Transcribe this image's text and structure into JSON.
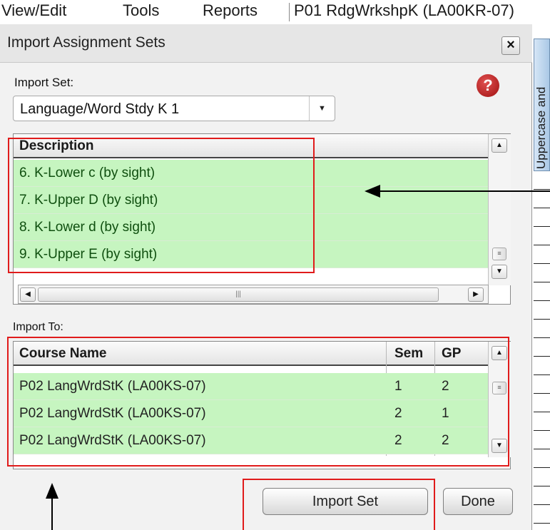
{
  "menubar": {
    "items": [
      "View/Edit",
      "Tools",
      "Reports"
    ],
    "course_context": "P01  RdgWrkshpK (LA00KR-07)"
  },
  "dialog": {
    "title": "Import Assignment Sets",
    "import_set_label": "Import Set:",
    "import_set_value": "Language/Word Stdy K 1",
    "description": {
      "header": "Description",
      "rows": [
        "6. K-Lower c (by sight)",
        "7. K-Upper D (by sight)",
        "8. K-Lower d (by sight)",
        "9. K-Upper E (by sight)"
      ]
    },
    "import_to_label": "Import To:",
    "courses": {
      "headers": {
        "course_name": "Course Name",
        "sem": "Sem",
        "gp": "GP"
      },
      "rows": [
        {
          "course_name": "P02   LangWrdStK (LA00KS-07)",
          "sem": "1",
          "gp": "2"
        },
        {
          "course_name": "P02   LangWrdStK (LA00KS-07)",
          "sem": "2",
          "gp": "1"
        },
        {
          "course_name": "P02   LangWrdStK (LA00KS-07)",
          "sem": "2",
          "gp": "2"
        }
      ]
    },
    "buttons": {
      "import_set": "Import Set",
      "done": "Done",
      "close": "×"
    }
  },
  "right_panel": {
    "tab_label": "Uppercase and"
  },
  "colors": {
    "row_highlight": "#c6f5c0",
    "annotation_red": "#e01b1b",
    "help_icon": "#c0201f"
  },
  "icons": {
    "close": "close-icon",
    "help": "help-icon",
    "dropdown": "chevron-down-icon",
    "scroll_up": "scroll-up-arrow-icon",
    "scroll_down": "scroll-down-arrow-icon",
    "scroll_left": "scroll-left-arrow-icon",
    "scroll_right": "scroll-right-arrow-icon"
  }
}
